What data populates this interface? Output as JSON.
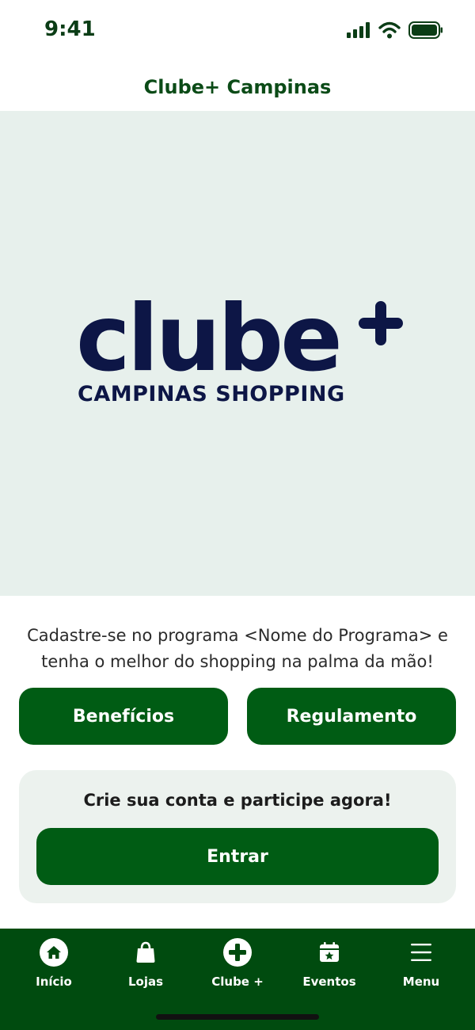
{
  "status_bar": {
    "time": "9:41",
    "icons": [
      "signal-icon",
      "wifi-icon",
      "battery-icon"
    ]
  },
  "header": {
    "title": "Clube+ Campinas"
  },
  "hero": {
    "logo_word": "clube",
    "logo_subtitle": "CAMPINAS SHOPPING",
    "background": "#e7f0ec",
    "logo_color": "#0d1646"
  },
  "intro": {
    "text": "Cadastre-se no programa <Nome do Programa> e tenha o melhor do shopping na palma da mão!"
  },
  "actions": {
    "benefits_label": "Benefícios",
    "rules_label": "Regulamento"
  },
  "signup": {
    "title": "Crie sua conta e participe agora!",
    "enter_label": "Entrar"
  },
  "bottom_nav": {
    "items": [
      {
        "label": "Início",
        "icon": "home-icon"
      },
      {
        "label": "Lojas",
        "icon": "shopping-bag-icon"
      },
      {
        "label": "Clube +",
        "icon": "plus-circle-icon"
      },
      {
        "label": "Eventos",
        "icon": "calendar-star-icon"
      },
      {
        "label": "Menu",
        "icon": "hamburger-menu-icon"
      }
    ]
  },
  "colors": {
    "primary_green": "#005c14",
    "nav_green": "#004b0f",
    "header_text": "#0b4b17",
    "card_bg": "#ecf2ee"
  }
}
